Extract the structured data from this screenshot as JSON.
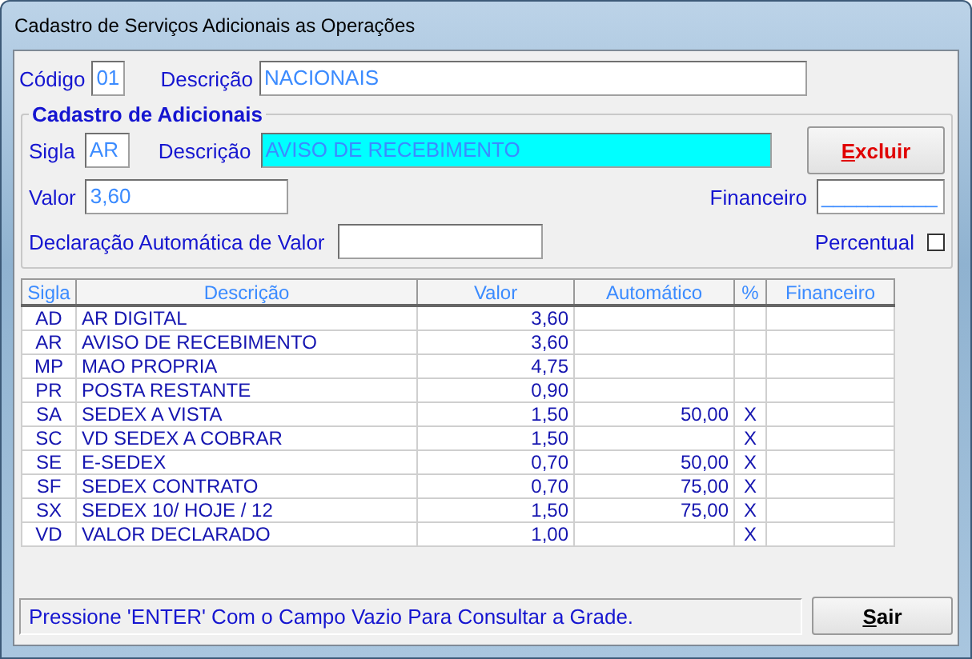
{
  "window": {
    "title": "Cadastro de Serviços Adicionais as Operações"
  },
  "header": {
    "codigo_label": "Código",
    "codigo": "01",
    "descricao_label": "Descrição",
    "descricao": "NACIONAIS"
  },
  "group": {
    "title": "Cadastro de Adicionais",
    "sigla_label": "Sigla",
    "sigla": "AR",
    "descricao_label": "Descrição",
    "descricao": "AVISO DE RECEBIMENTO",
    "excluir": "Excluir",
    "valor_label": "Valor",
    "valor": "3,60",
    "financeiro_label": "Financeiro",
    "financeiro": "__________",
    "declaracao_label": "Declaração Automática de Valor",
    "percentual_label": "Percentual",
    "percentual_checked": false
  },
  "table": {
    "columns": [
      "Sigla",
      "Descrição",
      "Valor",
      "Automático",
      "%",
      "Financeiro"
    ],
    "rows": [
      {
        "sigla": "AD",
        "descricao": "AR DIGITAL",
        "valor": "3,60"
      },
      {
        "sigla": "AR",
        "descricao": "AVISO DE RECEBIMENTO",
        "valor": "3,60"
      },
      {
        "sigla": "MP",
        "descricao": "MAO PROPRIA",
        "valor": "4,75"
      },
      {
        "sigla": "PR",
        "descricao": "POSTA RESTANTE",
        "valor": "0,90"
      },
      {
        "sigla": "SA",
        "descricao": "SEDEX A VISTA",
        "valor": "1,50",
        "automatico": "50,00",
        "pct": "X"
      },
      {
        "sigla": "SC",
        "descricao": "VD SEDEX A COBRAR",
        "valor": "1,50",
        "pct": "X"
      },
      {
        "sigla": "SE",
        "descricao": "E-SEDEX",
        "valor": "0,70",
        "automatico": "50,00",
        "pct": "X"
      },
      {
        "sigla": "SF",
        "descricao": "SEDEX CONTRATO",
        "valor": "0,70",
        "automatico": "75,00",
        "pct": "X"
      },
      {
        "sigla": "SX",
        "descricao": "SEDEX 10/ HOJE / 12",
        "valor": "1,50",
        "automatico": "75,00",
        "pct": "X"
      },
      {
        "sigla": "VD",
        "descricao": "VALOR DECLARADO",
        "valor": "1,00",
        "pct": "X"
      }
    ]
  },
  "status": {
    "message": "Pressione 'ENTER' Com o Campo Vazio Para Consultar a Grade.",
    "sair": "Sair"
  }
}
